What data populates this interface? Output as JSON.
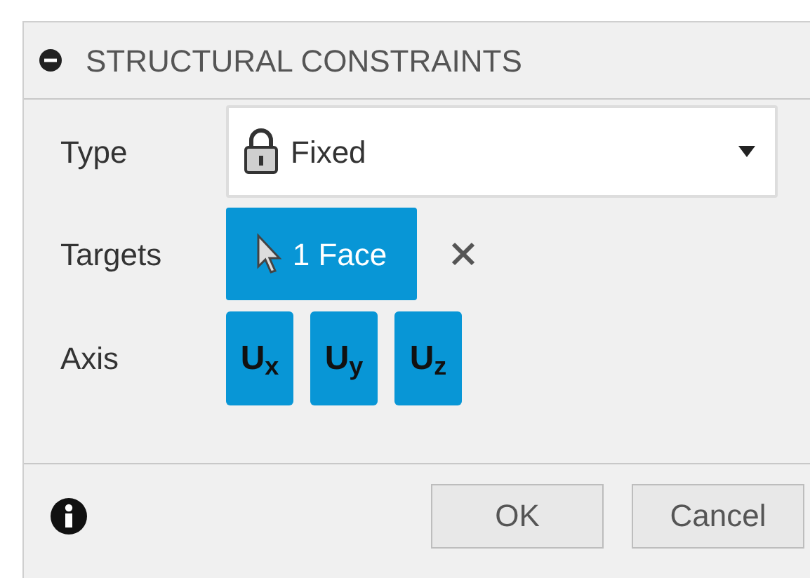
{
  "panel": {
    "title": "STRUCTURAL CONSTRAINTS",
    "expanded": true
  },
  "type": {
    "label": "Type",
    "value": "Fixed"
  },
  "targets": {
    "label": "Targets",
    "selection": "1 Face"
  },
  "axis": {
    "label": "Axis",
    "buttons": [
      {
        "label": "U$_{x}$",
        "selected": true
      },
      {
        "label": "U$_{y}$",
        "selected": true
      },
      {
        "label": "U$_{z}$",
        "selected": true
      }
    ]
  },
  "buttons": [
    "OK",
    "Cancel"
  ]
}
